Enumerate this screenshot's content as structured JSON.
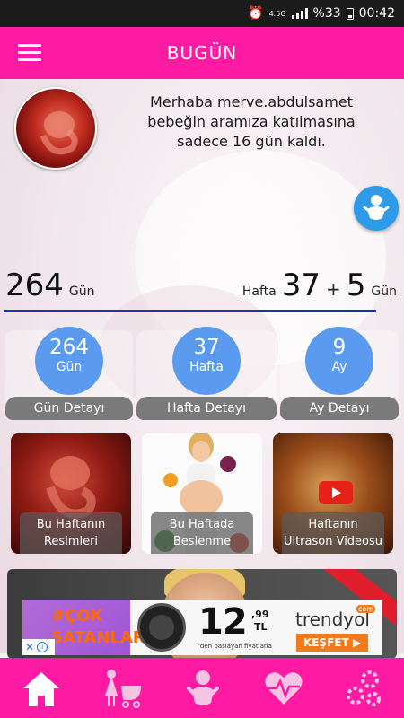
{
  "status_bar": {
    "network": "4.5G",
    "battery": "%33",
    "time": "00:42"
  },
  "app_bar": {
    "title": "BUGÜN",
    "menu_icon": "hamburger-menu-icon"
  },
  "greeting": {
    "line1": "Merhaba merve.abdulsamet",
    "line2": "bebeğin aramıza katılmasına",
    "line3": "sadece 16 gün kaldı."
  },
  "counters": {
    "days_value": "264",
    "days_unit": "Gün",
    "week_prefix": "Hafta",
    "week_value": "37",
    "plus": "+",
    "extra_days": "5",
    "extra_unit": "Gün",
    "progress_fraction": 0.94
  },
  "summary_cards": [
    {
      "value": "264",
      "unit": "Gün",
      "label": "Gün Detayı"
    },
    {
      "value": "37",
      "unit": "Hafta",
      "label": "Hafta Detayı"
    },
    {
      "value": "9",
      "unit": "Ay",
      "label": "Ay Detayı"
    }
  ],
  "tiles": [
    {
      "line1": "Bu Haftanın",
      "line2": "Resimleri"
    },
    {
      "line1": "Bu Haftada",
      "line2": "Beslenme"
    },
    {
      "line1": "Haftanın",
      "line2": "Ultrason Videosu"
    }
  ],
  "ad": {
    "line1": "#ÇOK",
    "line2": "SATANLAR",
    "price": "12",
    "price_cents": ",99",
    "currency": "TL",
    "price_note": "'den başlayan fiyatlarla",
    "brand": "trendyol",
    "brand_suffix": "com",
    "cta": "KEŞFET ▶"
  },
  "colors": {
    "primary": "#ff1aa3",
    "card_circle": "#5b9bef",
    "progress": "#1f2fb8",
    "fab": "#2e9be8"
  },
  "bottom_nav": [
    "home-icon",
    "mother-stroller-icon",
    "baby-icon",
    "heartbeat-icon",
    "settings-gears-icon"
  ]
}
